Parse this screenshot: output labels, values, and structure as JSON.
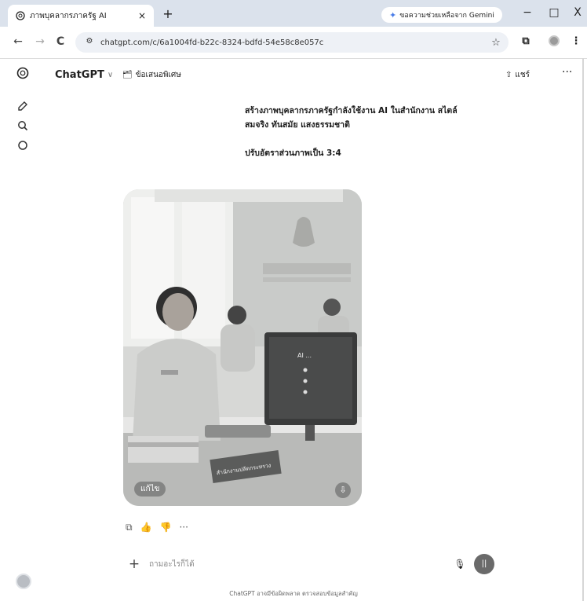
{
  "browser": {
    "tab_title": "ภาพบุคลากรภาครัฐ AI",
    "tab_close": "×",
    "new_tab": "+",
    "gemini_label": "ขอความช่วยเหลือจาก Gemini",
    "url": "chatgpt.com/c/6a1004fd-b22c-8324-bdfd-54e58c8e057c",
    "nav": {
      "back": "←",
      "forward": "→",
      "reload": "C"
    },
    "window": {
      "minimize": "−",
      "maximize": "□",
      "close": "X"
    }
  },
  "app": {
    "model_name": "ChatGPT",
    "temporary_chat_label": "ข้อเสนอพิเศษ",
    "share_label": "แชร์",
    "more": "···"
  },
  "conversation": {
    "user_message": {
      "line1": "สร้างภาพบุคลากรภาครัฐกำลังใช้งาน AI ในสำนักงาน สไตล์",
      "line2": "สมจริง ทันสมัย แสงธรรมชาติ",
      "line3": "ปรับอัตราส่วนภาพเป็น 3:4"
    },
    "image": {
      "edit_label": "แก้ไข",
      "desk_sign": "สำนักงานปลัดกระทรวง",
      "screen_text": "AI ..."
    },
    "actions": [
      "copy-icon",
      "thumbs-up-icon",
      "thumbs-down-icon",
      "more-icon"
    ]
  },
  "composer": {
    "placeholder": "ถามอะไรก็ได้",
    "plus": "+"
  },
  "footer": {
    "disclaimer": "ChatGPT อาจมีข้อผิดพลาด ตรวจสอบข้อมูลสำคัญ"
  }
}
